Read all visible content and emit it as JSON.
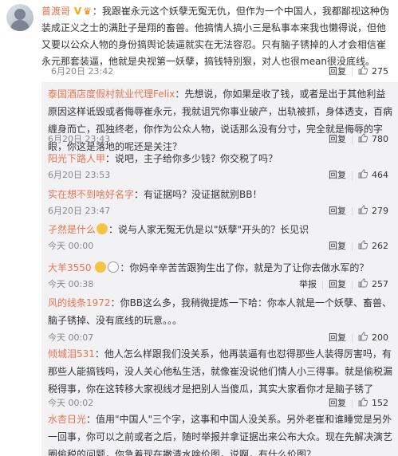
{
  "main_comment": {
    "username": "普渡哥",
    "badges": [
      "V",
      "会员"
    ],
    "content": "我跟崔永元这个妖孽无冤无仇，但作为一个中国人，我都鄙视这种伪装成正义之士的满肚子是翔的畜兽。他搞情人搞小三是私事本来我也懒得说，但他又要以公众人物的身份搞舆论装逼就实在无法容忍。只有脑子锈掉的人才会相信崔永元那套装逼，他就是央视第一妖孽，搞钱特别狠，对人也很mean很没底线。",
    "time": "6月20日 23:42",
    "reply_label": "回复",
    "likes": "275"
  },
  "replies": [
    {
      "username": "泰国酒店度假村就业代理Felix",
      "content": "先想说，你如果是收了钱，或者是出于其他利益原因这样诋毁或者侮辱崔永元，我就诅咒你事业破产，出轨被抓，身体透支，百病缠身而亡，孤独终老，你作为公众人物，说话那么没有分寸，完全就是侮辱的字眼，你这是落地的呢还是关注？",
      "time": "6月20日 23:43",
      "reply_label": "回复",
      "likes": "780"
    },
    {
      "username": "阳光下路人甲",
      "content": "说吧，主子给你多少钱？你交税了吗？",
      "time": "6月20日 23:53",
      "reply_label": "回复",
      "likes": "464"
    },
    {
      "username": "实在想不到啥好名字",
      "content": "有证据吗？没证据就别BB！",
      "time": "6月20日 23:47",
      "reply_label": "回复",
      "likes": "279"
    },
    {
      "username": "孑然是什么",
      "content": "说与人家无冤无仇是以\"妖孽\"开头的？长见识",
      "time": "今天 00:00",
      "reply_label": "回复",
      "likes": "262"
    },
    {
      "username": "大羊3550",
      "content": "你妈辛辛苦苦跟狗生出了你，就是为了让你去做水军的？",
      "time": "今天 00:38",
      "report_label": "举报",
      "reply_label": "回复",
      "likes": "257"
    },
    {
      "username": "风的线条1972",
      "content": "你BB这么多，我稍微提炼一下哈：你本人就是一个妖孽、畜兽、脑子锈掉、没有底线的玩意。。。",
      "time": "今天 00:07",
      "reply_label": "回复",
      "likes": "200"
    },
    {
      "username": "倾城泪531",
      "content": "他人怎么样跟我们没关系，他再装逼有也怼得那些人装得厉害吗，有那些人能搞钱吗，没人关心他私生活，就像崔没说他们情人小三得事。就是偷税漏税得事，你在这转移大家视线才是把别人当傻瓜，其实大家看你才是脑子锈了",
      "time": "今天 00:02",
      "reply_label": "回复",
      "likes": "152"
    },
    {
      "username": "水杏日光",
      "content": "值用\"中国人\"三个字，这事和中国人没关系。另外老崔和谁睡觉是另外一回事，你可以之前或者之后，随时举报并拿证据出来公布大众。现在先解决演艺圈偷税的问题，你急着现在撇清水啥价图，说啊，有什么价图？",
      "time": "",
      "reply_label": "",
      "likes": ""
    }
  ]
}
